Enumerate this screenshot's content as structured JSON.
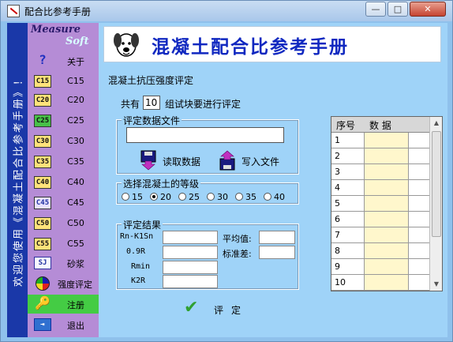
{
  "window": {
    "title": "配合比参考手册",
    "min_label": "—",
    "max_label": "□",
    "close_label": "✕"
  },
  "banner": {
    "text": "欢迎您使用《混凝土配合比参考手册》！"
  },
  "sidebar": {
    "logo_line1": "Measure",
    "logo_line2": "Soft",
    "items": [
      {
        "icon": "?",
        "label": "关于"
      },
      {
        "icon": "C15",
        "label": "C15"
      },
      {
        "icon": "C20",
        "label": "C20"
      },
      {
        "icon": "C25",
        "label": "C25"
      },
      {
        "icon": "C30",
        "label": "C30"
      },
      {
        "icon": "C35",
        "label": "C35"
      },
      {
        "icon": "C40",
        "label": "C40"
      },
      {
        "icon": "C45",
        "label": "C45"
      },
      {
        "icon": "C50",
        "label": "C50"
      },
      {
        "icon": "C55",
        "label": "C55"
      },
      {
        "icon": "SJ",
        "label": "砂浆"
      },
      {
        "icon": "",
        "label": "强度评定"
      },
      {
        "icon": "🔑",
        "label": "注册"
      },
      {
        "icon": "⇥",
        "label": "退出"
      }
    ]
  },
  "header": {
    "title": "混凝土配合比参考手册"
  },
  "main": {
    "section_title": "混凝土抗压强度评定",
    "count_prefix": "共有",
    "count_value": "10",
    "count_suffix": "组试块要进行评定",
    "file_group": {
      "title": "评定数据文件",
      "file_value": "",
      "read_label": "读取数据",
      "write_label": "写入文件"
    },
    "grade_group": {
      "title": "选择混凝土的等级",
      "options": [
        "15",
        "20",
        "25",
        "30",
        "35",
        "40"
      ],
      "selected": "20"
    },
    "result_group": {
      "title": "评定结果",
      "labels": [
        "Rn-K1Sn",
        "0.9R",
        "Rmin",
        "K2R"
      ],
      "avg_label": "平均值:",
      "std_label": "标准差:"
    },
    "evaluate_label": "评定"
  },
  "table": {
    "headers": [
      "序号",
      "数 据"
    ],
    "rows": [
      "1",
      "2",
      "3",
      "4",
      "5",
      "6",
      "7",
      "8",
      "9",
      "10"
    ]
  },
  "colors": {
    "background": "#9fd3f8",
    "sidebar": "#b58cd6",
    "banner": "#1a38a8",
    "header_title": "#1028c0",
    "active_item": "#44cc44"
  }
}
